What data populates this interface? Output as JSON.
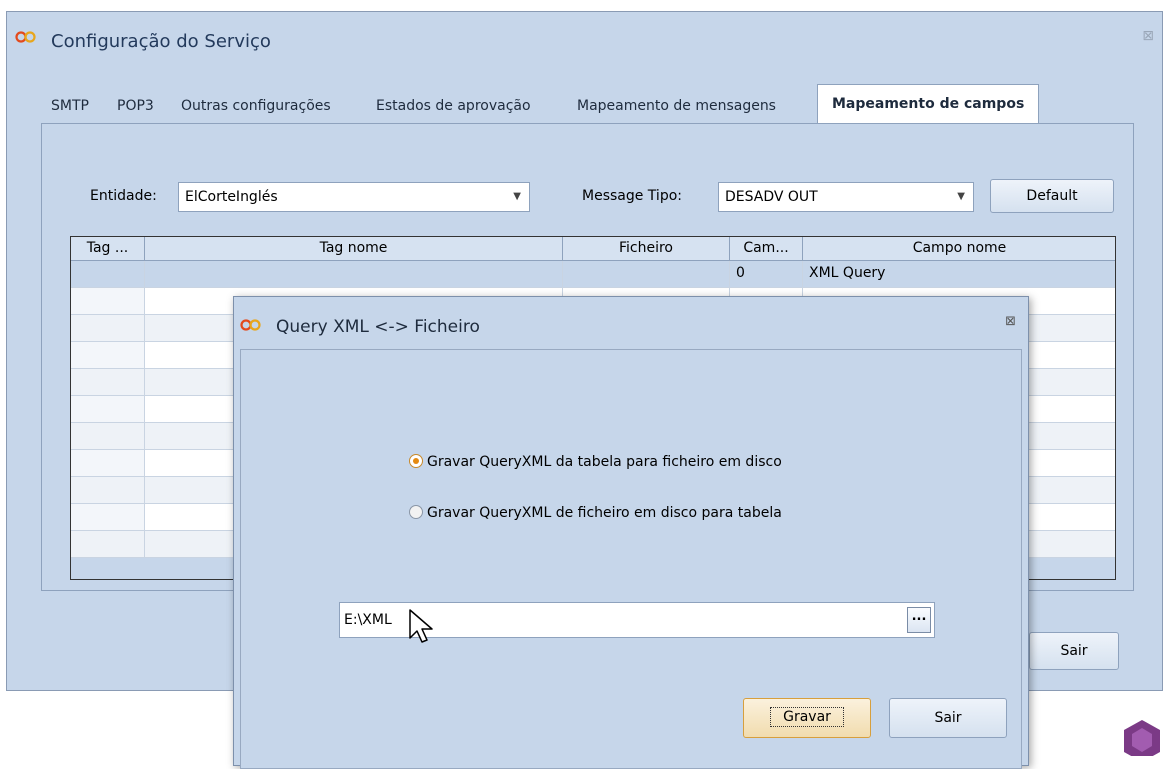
{
  "main_window": {
    "title": "Configuração do Serviço",
    "close_glyph": "⊠",
    "tabs": [
      {
        "label": "SMTP"
      },
      {
        "label": "POP3"
      },
      {
        "label": "Outras configurações"
      },
      {
        "label": "Estados de aprovação"
      },
      {
        "label": "Mapeamento de mensagens"
      },
      {
        "label": "Mapeamento de campos",
        "active": true
      }
    ],
    "entidade_label": "Entidade:",
    "entidade_value": "ElCorteInglés",
    "message_tipo_label": "Message Tipo:",
    "message_tipo_value": "DESADV OUT",
    "default_button": "Default",
    "grid": {
      "headers": [
        "Tag ...",
        "Tag nome",
        "Ficheiro",
        "Cam...",
        "Campo nome"
      ],
      "rows": [
        [
          "",
          "",
          "",
          "0",
          "XML Query"
        ]
      ]
    },
    "sair_button": "Sair"
  },
  "dialog": {
    "title": "Query XML <-> Ficheiro",
    "close_glyph": "⊠",
    "option_1": "Gravar QueryXML da tabela para ficheiro em disco",
    "option_2": "Gravar QueryXML de ficheiro em disco para tabela",
    "selected_option": 1,
    "path_value": "E:\\XML",
    "browse_label": "...",
    "gravar_button": "Gravar",
    "sair_button": "Sair"
  },
  "colors": {
    "window_bg": "#c6d6ea",
    "radio_selected": "#e58a10",
    "gravar_border": "#d79f3d"
  }
}
